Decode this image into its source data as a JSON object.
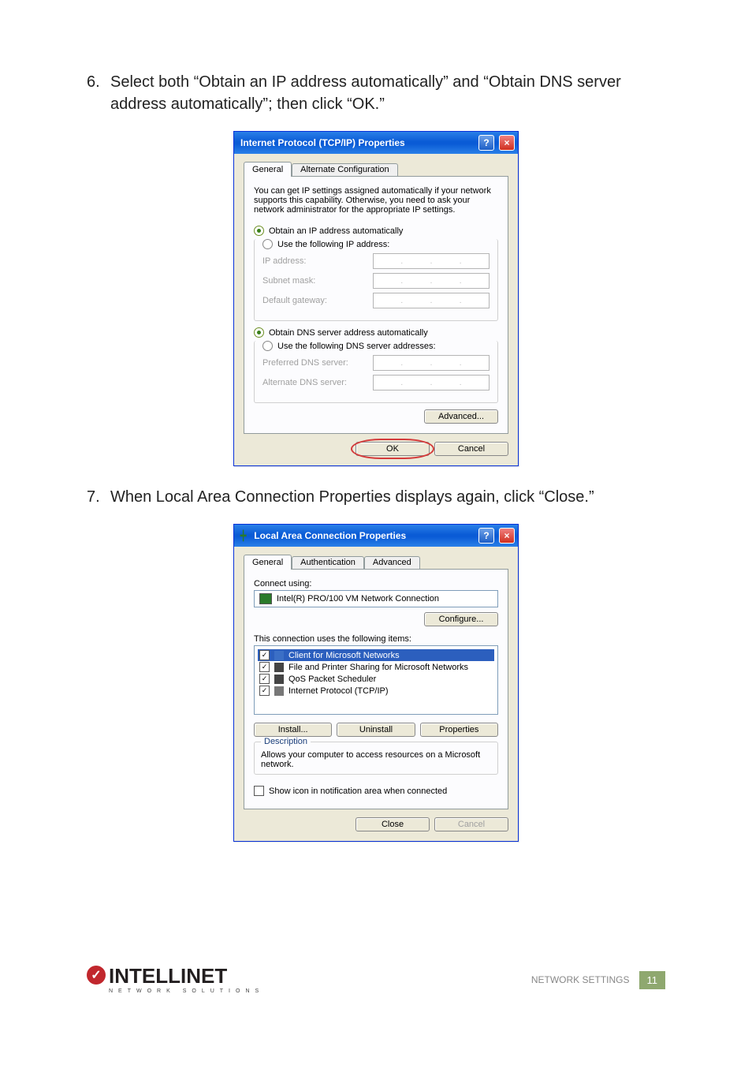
{
  "step6": {
    "num": "6.",
    "text": "Select both “Obtain an IP address automatically” and “Obtain DNS server address automatically”; then click “OK.”"
  },
  "step7": {
    "num": "7.",
    "text": "When Local Area Connection Properties displays again, click “Close.”"
  },
  "tcpip": {
    "title": "Internet Protocol (TCP/IP) Properties",
    "tabs": {
      "general": "General",
      "alt": "Alternate Configuration"
    },
    "desc": "You can get IP settings assigned automatically if your network supports this capability. Otherwise, you need to ask your network administrator for the appropriate IP settings.",
    "radio_auto_ip": "Obtain an IP address automatically",
    "radio_use_ip": "Use the following IP address:",
    "ip_label": "IP address:",
    "subnet_label": "Subnet mask:",
    "gateway_label": "Default gateway:",
    "radio_auto_dns": "Obtain DNS server address automatically",
    "radio_use_dns": "Use the following DNS server addresses:",
    "pref_dns": "Preferred DNS server:",
    "alt_dns": "Alternate DNS server:",
    "advanced": "Advanced...",
    "ok": "OK",
    "cancel": "Cancel"
  },
  "lac": {
    "title": "Local Area Connection Properties",
    "tabs": {
      "general": "General",
      "auth": "Authentication",
      "adv": "Advanced"
    },
    "connect_using": "Connect using:",
    "adapter": "Intel(R) PRO/100 VM Network Connection",
    "configure": "Configure...",
    "uses_items": "This connection uses the following items:",
    "items": [
      "Client for Microsoft Networks",
      "File and Printer Sharing for Microsoft Networks",
      "QoS Packet Scheduler",
      "Internet Protocol (TCP/IP)"
    ],
    "install": "Install...",
    "uninstall": "Uninstall",
    "properties": "Properties",
    "description_legend": "Description",
    "description_text": "Allows your computer to access resources on a Microsoft network.",
    "show_icon": "Show icon in notification area when connected",
    "close": "Close",
    "cancel": "Cancel"
  },
  "footer": {
    "section": "NETWORK SETTINGS",
    "page": "11",
    "logo_name": "INTELLINET",
    "logo_sub": "NETWORK SOLUTIONS"
  }
}
